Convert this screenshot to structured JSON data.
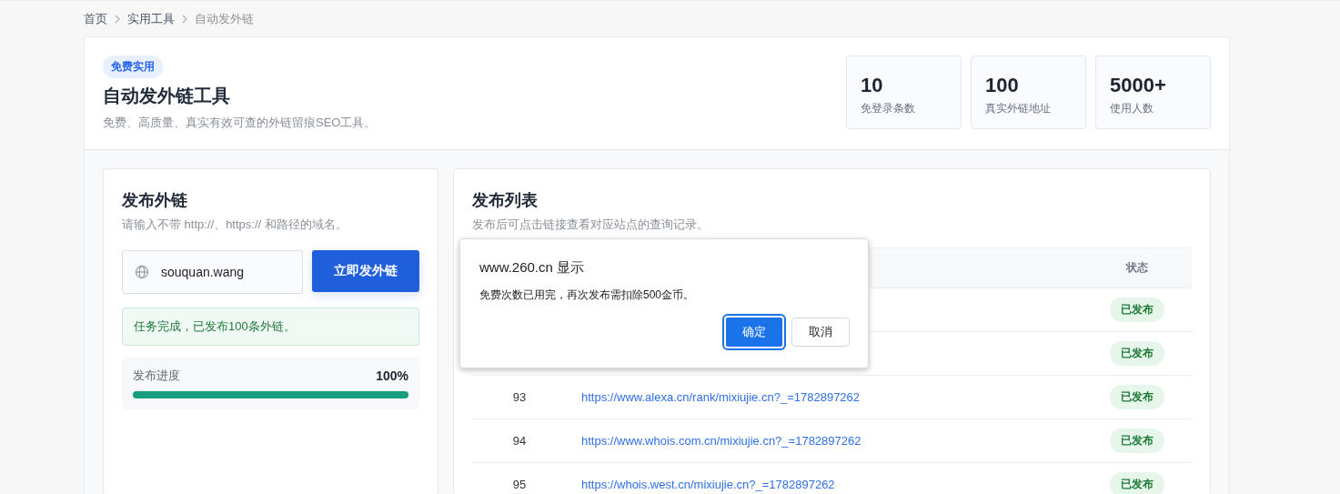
{
  "breadcrumb": [
    {
      "label": "首页"
    },
    {
      "label": "实用工具"
    },
    {
      "label": "自动发外链"
    }
  ],
  "header": {
    "badge": "免费实用",
    "title": "自动发外链工具",
    "subtitle": "免费、高质量、真实有效可查的外链留痕SEO工具。",
    "stats": [
      {
        "value": "10",
        "label": "免登录条数"
      },
      {
        "value": "100",
        "label": "真实外链地址"
      },
      {
        "value": "5000+",
        "label": "使用人数"
      }
    ]
  },
  "publish": {
    "title": "发布外链",
    "hint": "请输入不带 http://、https:// 和路径的域名。",
    "domain": "souquan.wang",
    "button": "立即发外链",
    "alert": "任务完成，已发布100条外链。",
    "progress": {
      "label": "发布进度",
      "reading": "100%",
      "level": 1
    }
  },
  "list": {
    "title": "发布列表",
    "subtitle": "发布后可点击链接查看对应站点的查询记录。",
    "status_column": "状态",
    "rows": [
      {
        "status": "已发布"
      },
      {
        "status": "已发布"
      },
      {
        "number": "93",
        "link": "https://www.alexa.cn/rank/mixiujie.cn?_=1782897262",
        "status": "已发布"
      },
      {
        "number": "94",
        "link": "https://www.whois.com.cn/mixiujie.cn?_=1782897262",
        "status": "已发布"
      },
      {
        "number": "95",
        "link": "https://whois.west.cn/mixiujie.cn?_=1782897262",
        "status": "已发布"
      }
    ]
  },
  "dialog": {
    "title": "www.260.cn 显示",
    "message": "免费次数已用完，再次发布需扣除500金币。",
    "buttons": [
      {
        "label": "确定",
        "selected": true
      },
      {
        "label": "取消",
        "selected": false
      }
    ]
  }
}
